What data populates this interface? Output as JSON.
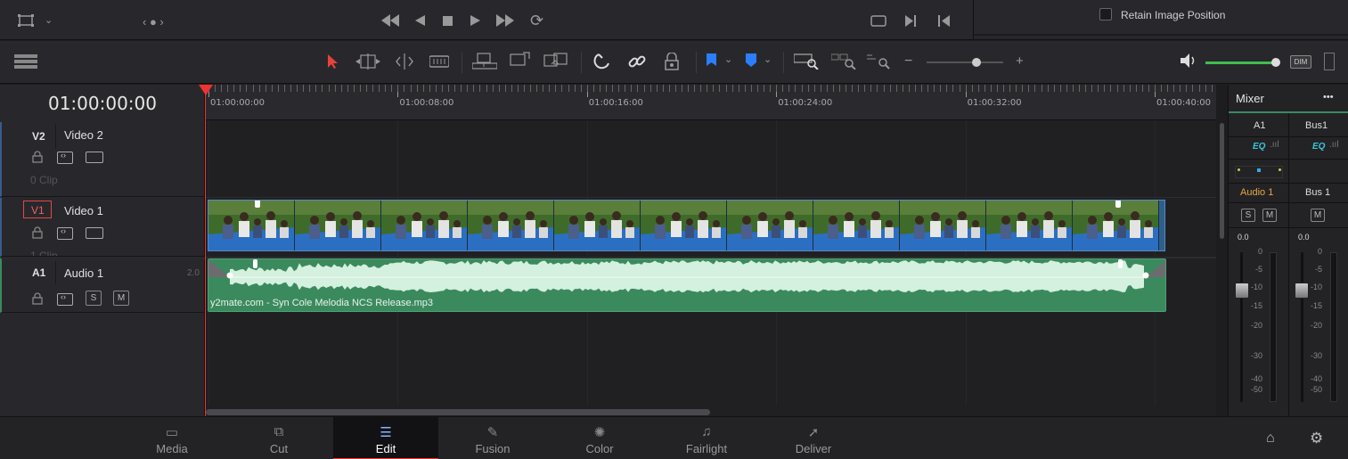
{
  "inspector": {
    "retain_image_position_label": "Retain Image Position",
    "retain_checked": false
  },
  "timeline": {
    "timecode": "01:00:00:00",
    "ruler_labels": [
      "01:00:00:00",
      "01:00:08:00",
      "01:00:16:00",
      "01:00:24:00",
      "01:00:32:00",
      "01:00:40:00"
    ]
  },
  "tracks": {
    "v2": {
      "id": "V2",
      "name": "Video 2",
      "clip_count": "0 Clip"
    },
    "v1": {
      "id": "V1",
      "name": "Video 1",
      "clip_count": "1 Clip"
    },
    "a1": {
      "id": "A1",
      "name": "Audio 1",
      "channel": "2.0",
      "solo": "S",
      "mute": "M"
    }
  },
  "clips": {
    "audio_name": "y2mate.com - Syn Cole  Melodia NCS Release.mp3"
  },
  "mixer": {
    "title": "Mixer",
    "menu": "•••",
    "col1": {
      "header": "A1",
      "eq": "EQ",
      "name": "Audio 1",
      "solo": "S",
      "mute": "M",
      "level": "0.0"
    },
    "col2": {
      "header": "Bus1",
      "eq": "EQ",
      "name": "Bus 1",
      "mute": "M",
      "level": "0.0"
    },
    "scale": [
      "0",
      "-5",
      "-10",
      "-15",
      "-20",
      "-30",
      "-40",
      "-50"
    ],
    "scale2": [
      "0",
      "-5",
      "-10",
      "-15",
      "-20",
      "-30",
      "-40",
      "-50"
    ]
  },
  "toolbar": {
    "dim_label": "DIM"
  },
  "pages": [
    "Media",
    "Cut",
    "Edit",
    "Fusion",
    "Color",
    "Fairlight",
    "Deliver"
  ],
  "active_page": "Edit",
  "colors": {
    "accent_red": "#e33333",
    "video_clip": "#2d5f8a",
    "audio_clip": "#3b8a5e",
    "eq": "#38c6d6",
    "track_name_orange": "#e8a740"
  }
}
